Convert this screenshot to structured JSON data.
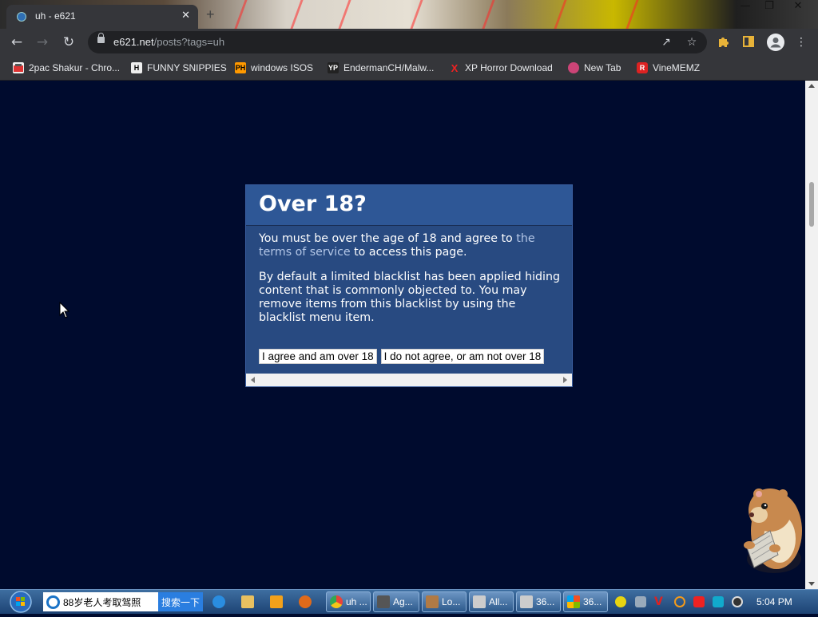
{
  "browser": {
    "tab_title": "uh - e621",
    "tab_close": "✕",
    "new_tab": "+",
    "window_controls": {
      "minimize": "—",
      "maximize": "❐",
      "close": "✕"
    },
    "url_host": "e621.net",
    "url_path": "/posts?tags=uh"
  },
  "bookmarks": [
    {
      "label": "2pac Shakur - Chro...",
      "icon": "bookmark-favicon",
      "color": "#d33"
    },
    {
      "label": "FUNNY SNIPPIES",
      "icon": "H",
      "color": "#eee"
    },
    {
      "label": "windows ISOS",
      "icon": "PH",
      "color": "#f90"
    },
    {
      "label": "EndermanCH/Malw...",
      "icon": "YP",
      "color": "#222"
    },
    {
      "label": "XP Horror Download",
      "icon": "X",
      "color": "#e22"
    },
    {
      "label": "New Tab",
      "icon": "globe-icon",
      "color": "#c47"
    },
    {
      "label": "VineMEMZ",
      "icon": "R",
      "color": "#d22"
    }
  ],
  "dialog": {
    "title": "Over 18?",
    "p1_before": "You must be over the age of 18 and agree to ",
    "p1_link": "the terms of service",
    "p1_after": " to access this page.",
    "p2": "By default a limited blacklist has been applied hiding content that is commonly objected to. You may remove items from this blacklist by using the blacklist menu item.",
    "agree_label": "I agree and am over 18",
    "disagree_label": "I do not agree, or am not over 18"
  },
  "taskbar": {
    "search_text": "88岁老人考取驾照",
    "search_button": "搜索一下",
    "items": [
      {
        "label": "",
        "icon": "ie-icon",
        "color": "#2a8de0"
      },
      {
        "label": "",
        "icon": "folder-icon",
        "color": "#e8c060"
      },
      {
        "label": "",
        "icon": "media-player-icon",
        "color": "#f3a11a"
      },
      {
        "label": "",
        "icon": "app-icon",
        "color": "#e06a1a"
      },
      {
        "label": "uh ...",
        "icon": "chrome-icon",
        "color": "#e8433a"
      },
      {
        "label": "Ag...",
        "icon": "app-window-icon",
        "color": "#555"
      },
      {
        "label": "Lo...",
        "icon": "hamster-icon",
        "color": "#b07a45"
      },
      {
        "label": "All...",
        "icon": "window-icon",
        "color": "#ccc"
      },
      {
        "label": "36...",
        "icon": "window-icon",
        "color": "#ccc"
      },
      {
        "label": "36...",
        "icon": "windows-logo-icon",
        "color": "#3aa"
      }
    ],
    "tray_icons": [
      {
        "icon": "tray-green-icon",
        "color": "#e8d410"
      },
      {
        "icon": "tray-grid-icon",
        "color": "#9ab"
      },
      {
        "icon": "tray-v-icon",
        "color": "#d22"
      },
      {
        "icon": "tray-search-icon",
        "color": "#f39a1a"
      },
      {
        "icon": "tray-flag-icon",
        "color": "#e22"
      },
      {
        "icon": "tray-monitor-icon",
        "color": "#1ac"
      },
      {
        "icon": "tray-speaker-icon",
        "color": "#333"
      }
    ],
    "clock": "5:04 PM"
  }
}
